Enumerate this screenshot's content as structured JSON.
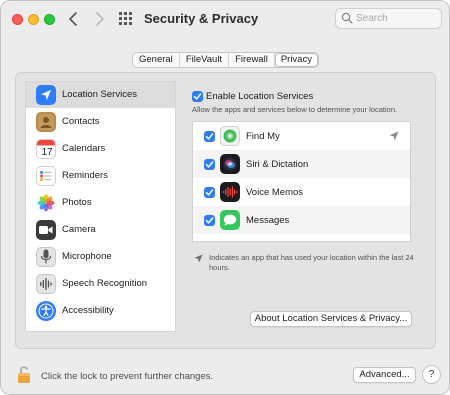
{
  "window": {
    "title": "Security & Privacy"
  },
  "search": {
    "placeholder": "Search"
  },
  "tabs": [
    {
      "label": "General",
      "active": false
    },
    {
      "label": "FileVault",
      "active": false
    },
    {
      "label": "Firewall",
      "active": false
    },
    {
      "label": "Privacy",
      "active": true
    }
  ],
  "sidebar": {
    "items": [
      {
        "label": "Location Services",
        "icon": "location-arrow-icon",
        "selected": true
      },
      {
        "label": "Contacts",
        "icon": "contacts-icon",
        "selected": false
      },
      {
        "label": "Calendars",
        "icon": "calendar-icon",
        "selected": false
      },
      {
        "label": "Reminders",
        "icon": "reminders-icon",
        "selected": false
      },
      {
        "label": "Photos",
        "icon": "photos-icon",
        "selected": false
      },
      {
        "label": "Camera",
        "icon": "camera-icon",
        "selected": false
      },
      {
        "label": "Microphone",
        "icon": "microphone-icon",
        "selected": false
      },
      {
        "label": "Speech Recognition",
        "icon": "speech-recognition-icon",
        "selected": false
      },
      {
        "label": "Accessibility",
        "icon": "accessibility-icon",
        "selected": false
      }
    ],
    "calendar_day": "17"
  },
  "location": {
    "enable_label": "Enable Location Services",
    "enabled": true,
    "description": "Allow the apps and services below to determine your location.",
    "apps": [
      {
        "name": "Find My",
        "icon": "find-my-icon",
        "checked": true,
        "recent_use": true
      },
      {
        "name": "Siri & Dictation",
        "icon": "siri-icon",
        "checked": true,
        "recent_use": false
      },
      {
        "name": "Voice Memos",
        "icon": "voice-memos-icon",
        "checked": true,
        "recent_use": false
      },
      {
        "name": "Messages",
        "icon": "messages-icon",
        "checked": true,
        "recent_use": false
      }
    ],
    "note": "Indicates an app that has used your location within the last 24 hours.",
    "about_button": "About Location Services & Privacy..."
  },
  "footer": {
    "lock_text": "Click the lock to prevent further changes.",
    "advanced_button": "Advanced...",
    "help_label": "?"
  },
  "colors": {
    "accent": "#2e7cf6",
    "close": "#ff5f57",
    "minimize": "#febc2e",
    "maximize": "#28c840",
    "lock": "#e8a33d"
  }
}
